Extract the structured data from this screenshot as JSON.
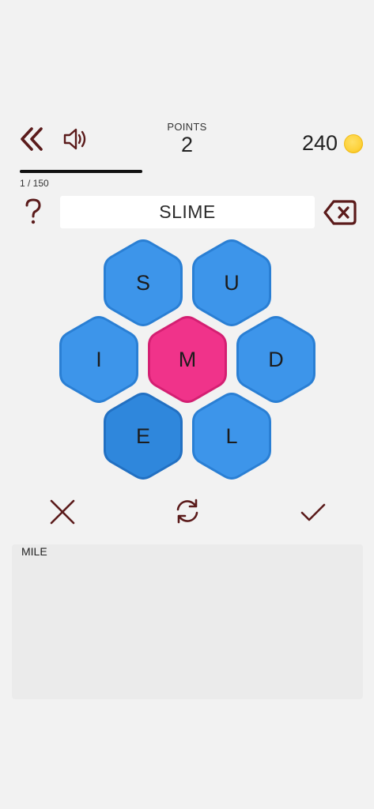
{
  "header": {
    "points_label": "POINTS",
    "points_value": "2",
    "coins_value": "240"
  },
  "progress": {
    "label": "1 / 150",
    "fraction": 1
  },
  "current_word": "SLIME",
  "board": {
    "tiles": [
      {
        "letter": "S",
        "state": "normal"
      },
      {
        "letter": "U",
        "state": "normal"
      },
      {
        "letter": "I",
        "state": "normal"
      },
      {
        "letter": "M",
        "state": "center"
      },
      {
        "letter": "D",
        "state": "normal"
      },
      {
        "letter": "E",
        "state": "pressed"
      },
      {
        "letter": "L",
        "state": "normal"
      }
    ]
  },
  "found_words": [
    "MILE"
  ],
  "colors": {
    "accent_dark_red": "#5b1b1b",
    "tile_blue": "#3d95ea",
    "tile_blue_pressed": "#2f87dc",
    "tile_center_pink": "#f0338a",
    "coin_gold": "#fdd23c"
  },
  "icons": {
    "back": "double-chevron-left-icon",
    "sound": "speaker-icon",
    "help": "question-mark-icon",
    "backspace": "backspace-icon",
    "clear": "close-icon",
    "shuffle": "refresh-icon",
    "submit": "checkmark-icon",
    "coin": "coin-icon"
  }
}
